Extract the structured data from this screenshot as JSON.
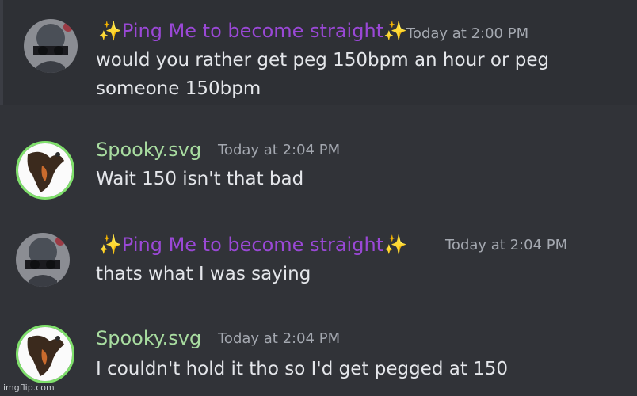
{
  "messages": [
    {
      "author": "✨Ping Me to become straight✨",
      "author_color": "#9a48d6",
      "timestamp": "Today at 2:00 PM",
      "body": "would you rather get peg 150bpm an hour or peg someone 150bpm"
    },
    {
      "author": "Spooky.svg",
      "author_color": "#a8dca0",
      "timestamp": "Today at 2:04 PM",
      "body": "Wait 150 isn't that bad"
    },
    {
      "author": "✨Ping Me to become straight✨",
      "author_color": "#9a48d6",
      "timestamp": "Today at 2:04 PM",
      "body": "thats what I was saying"
    },
    {
      "author": "Spooky.svg",
      "author_color": "#a8dca0",
      "timestamp": "Today at 2:04 PM",
      "body": "I couldn't hold it tho so I'd get pegged at 150"
    }
  ],
  "watermark": "imgflip.com"
}
